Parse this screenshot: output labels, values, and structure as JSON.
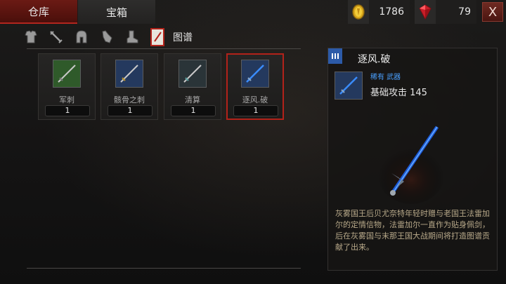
{
  "tabs": {
    "warehouse": "仓库",
    "chest": "宝箱"
  },
  "currency": {
    "gold": "1786",
    "gems": "79"
  },
  "close_label": "X",
  "categories": {
    "icons": [
      "armor-icon",
      "swords-icon",
      "helmet-icon",
      "glove-icon",
      "boot-icon",
      "recipe-book-icon"
    ],
    "active_label": "图谱"
  },
  "items": [
    {
      "name": "军刺",
      "count": "1",
      "color": "#2f5a2a"
    },
    {
      "name": "骸骨之刺",
      "count": "1",
      "color": "#24395e"
    },
    {
      "name": "清算",
      "count": "1",
      "color": "#2a3438"
    },
    {
      "name": "逐风.破",
      "count": "1",
      "color": "#24395e"
    }
  ],
  "selected_index": 3,
  "detail": {
    "title": "逐风.破",
    "rarity": "稀有 武器",
    "attack": "基础攻击 145",
    "description": "灰雾国王后贝尤奈特年轻时赠与老国王法雷加尔的定情信物，法雷加尔一直作为贴身佩剑，后在灰雾国与末那王国大战期间将打造图谱贡献了出来。"
  },
  "colors": {
    "accent_red": "#b3221a",
    "rarity_blue": "#4aa0ff"
  }
}
